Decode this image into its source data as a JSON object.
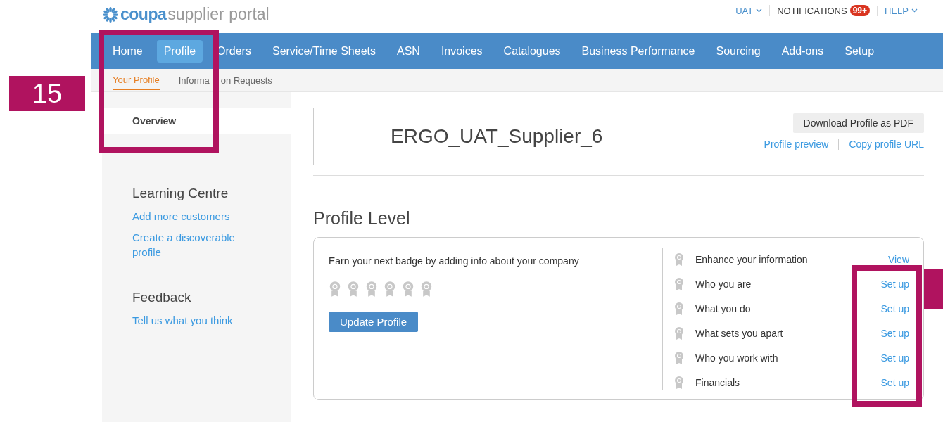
{
  "logo": {
    "brand": "coupa",
    "product": "supplier portal"
  },
  "top_links": [
    {
      "kind": "menu",
      "label": "UAT"
    },
    {
      "kind": "badge",
      "label": "NOTIFICATIONS",
      "badge": "99+"
    },
    {
      "kind": "menu",
      "label": "HELP"
    }
  ],
  "nav": [
    {
      "label": "Home",
      "selected": false
    },
    {
      "label": "Profile",
      "selected": true
    },
    {
      "label": "Orders",
      "selected": false
    },
    {
      "label": "Service/Time Sheets",
      "selected": false
    },
    {
      "label": "ASN",
      "selected": false
    },
    {
      "label": "Invoices",
      "selected": false
    },
    {
      "label": "Catalogues",
      "selected": false
    },
    {
      "label": "Business Performance",
      "selected": false
    },
    {
      "label": "Sourcing",
      "selected": false
    },
    {
      "label": "Add-ons",
      "selected": false
    },
    {
      "label": "Setup",
      "selected": false
    }
  ],
  "subnav": [
    {
      "label": "Your Profile",
      "selected": true
    },
    {
      "label_parts": [
        "Informa",
        "on Requests"
      ],
      "selected": false
    }
  ],
  "sidebar": {
    "items": [
      {
        "label": "Overview",
        "selected": true
      }
    ],
    "sections": [
      {
        "title": "Learning Centre",
        "links": [
          "Add more customers",
          "Create a discoverable profile"
        ]
      },
      {
        "title": "Feedback",
        "links": [
          "Tell us what you think"
        ]
      }
    ]
  },
  "profile": {
    "name": "ERGO_UAT_Supplier_6",
    "download_button": "Download Profile as PDF",
    "links": [
      "Profile preview",
      "Copy profile URL"
    ]
  },
  "profile_level": {
    "title": "Profile Level",
    "prompt": "Earn your next badge by adding info about your company",
    "badges": [
      {
        "earned": false
      },
      {
        "earned": false
      },
      {
        "earned": false
      },
      {
        "earned": false
      },
      {
        "earned": false
      },
      {
        "earned": false
      }
    ],
    "button": "Update Profile",
    "steps": [
      {
        "label": "Enhance your information",
        "action": "View",
        "done": false
      },
      {
        "label": "Who you are",
        "action": "Set up",
        "done": false
      },
      {
        "label": "What you do",
        "action": "Set up",
        "done": false
      },
      {
        "label": "What sets you apart",
        "action": "Set up",
        "done": false
      },
      {
        "label": "Who you work with",
        "action": "Set up",
        "done": false
      },
      {
        "label": "Financials",
        "action": "Set up",
        "done": false
      }
    ]
  },
  "annotations": [
    {
      "kind": "label",
      "text": "15"
    },
    {
      "kind": "outline"
    },
    {
      "kind": "outline"
    },
    {
      "kind": "block"
    }
  ]
}
